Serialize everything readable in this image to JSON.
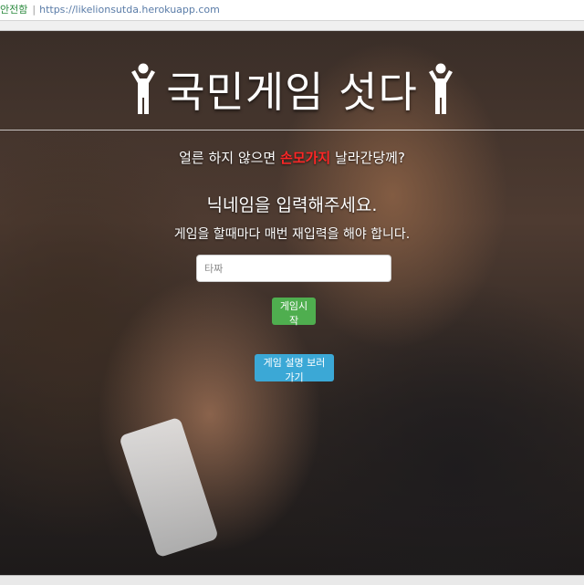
{
  "browser": {
    "security_label": "안전함",
    "url": "https://likelionsutda.herokuapp.com"
  },
  "header": {
    "title": "국민게임 섯다"
  },
  "intro": {
    "prefix": "얼른 하지 않으면 ",
    "emphasis": "손모가지",
    "suffix": " 날라간당께?"
  },
  "form": {
    "heading": "닉네임을 입력해주세요.",
    "note": "게임을 할때마다 매번 재입력을 해야 합니다.",
    "nickname_placeholder": "타짜",
    "start_label": "게임시작",
    "rules_label": "게임 설명 보러가기"
  },
  "colors": {
    "warning": "#ff2626",
    "start_button": "#4fae4f",
    "rules_button": "#3ba8d6"
  }
}
